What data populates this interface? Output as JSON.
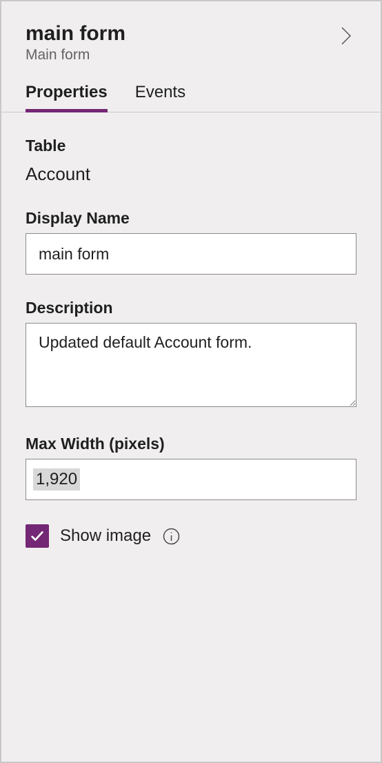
{
  "header": {
    "title": "main form",
    "subtitle": "Main form"
  },
  "tabs": {
    "properties": "Properties",
    "events": "Events"
  },
  "fields": {
    "table": {
      "label": "Table",
      "value": "Account"
    },
    "displayName": {
      "label": "Display Name",
      "value": "main form"
    },
    "description": {
      "label": "Description",
      "value": "Updated default Account form."
    },
    "maxWidth": {
      "label": "Max Width (pixels)",
      "value": "1,920"
    },
    "showImage": {
      "label": "Show image",
      "checked": true
    }
  },
  "colors": {
    "accent": "#742774"
  }
}
